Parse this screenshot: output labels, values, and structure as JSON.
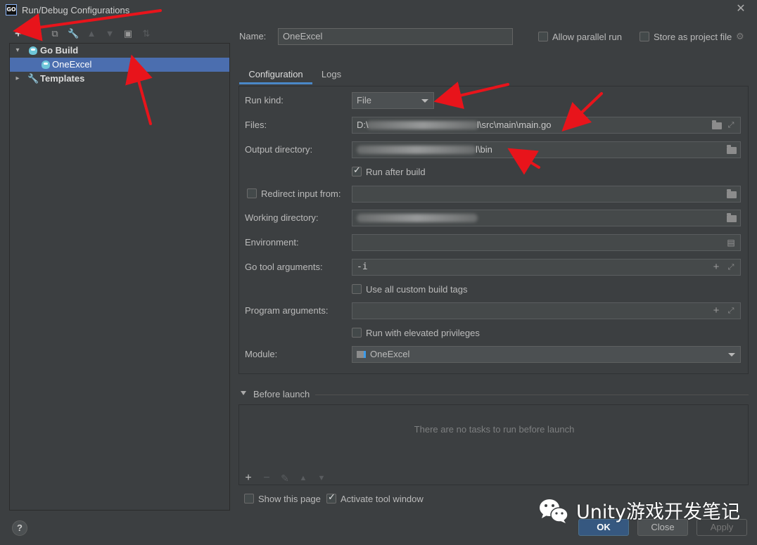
{
  "window": {
    "title": "Run/Debug Configurations",
    "app_icon_text": "GO"
  },
  "toolbar": {
    "icons": [
      "add-icon",
      "remove-icon",
      "copy-icon",
      "wrench-icon",
      "move-up-icon",
      "move-down-icon",
      "new-folder-icon",
      "sort-icon"
    ]
  },
  "tree": {
    "go_build": "Go Build",
    "one_excel": "OneExcel",
    "templates": "Templates"
  },
  "header": {
    "name_label": "Name:",
    "name_value": "OneExcel",
    "allow_parallel": "Allow parallel run",
    "store_as_project": "Store as project file"
  },
  "tabs": [
    {
      "label": "Configuration"
    },
    {
      "label": "Logs"
    }
  ],
  "form": {
    "run_kind_label": "Run kind:",
    "run_kind_value": "File",
    "files_label": "Files:",
    "files_visible_start": "D:\\",
    "files_value_suffix": "l\\src\\main\\main.go",
    "output_dir_label": "Output directory:",
    "output_dir_suffix": "l\\bin",
    "run_after_build": "Run after build",
    "redirect_input_label": "Redirect input from:",
    "working_dir_label": "Working directory:",
    "environment_label": "Environment:",
    "go_tool_args_label": "Go tool arguments:",
    "go_tool_args_value": "-i",
    "use_all_tags": "Use all custom build tags",
    "program_args_label": "Program arguments:",
    "run_elevated": "Run with elevated privileges",
    "module_label": "Module:",
    "module_value": "OneExcel"
  },
  "before_launch": {
    "title": "Before launch",
    "empty_text": "There are no tasks to run before launch"
  },
  "footer": {
    "show_this_page": "Show this page",
    "activate_tool_window": "Activate tool window",
    "ok": "OK",
    "close": "Close",
    "apply": "Apply",
    "help": "?"
  },
  "watermark": {
    "text": "Unity游戏开发笔记"
  },
  "colors": {
    "accent": "#4b6eaf",
    "arrow": "#e8141b",
    "background": "#3c3f41"
  }
}
